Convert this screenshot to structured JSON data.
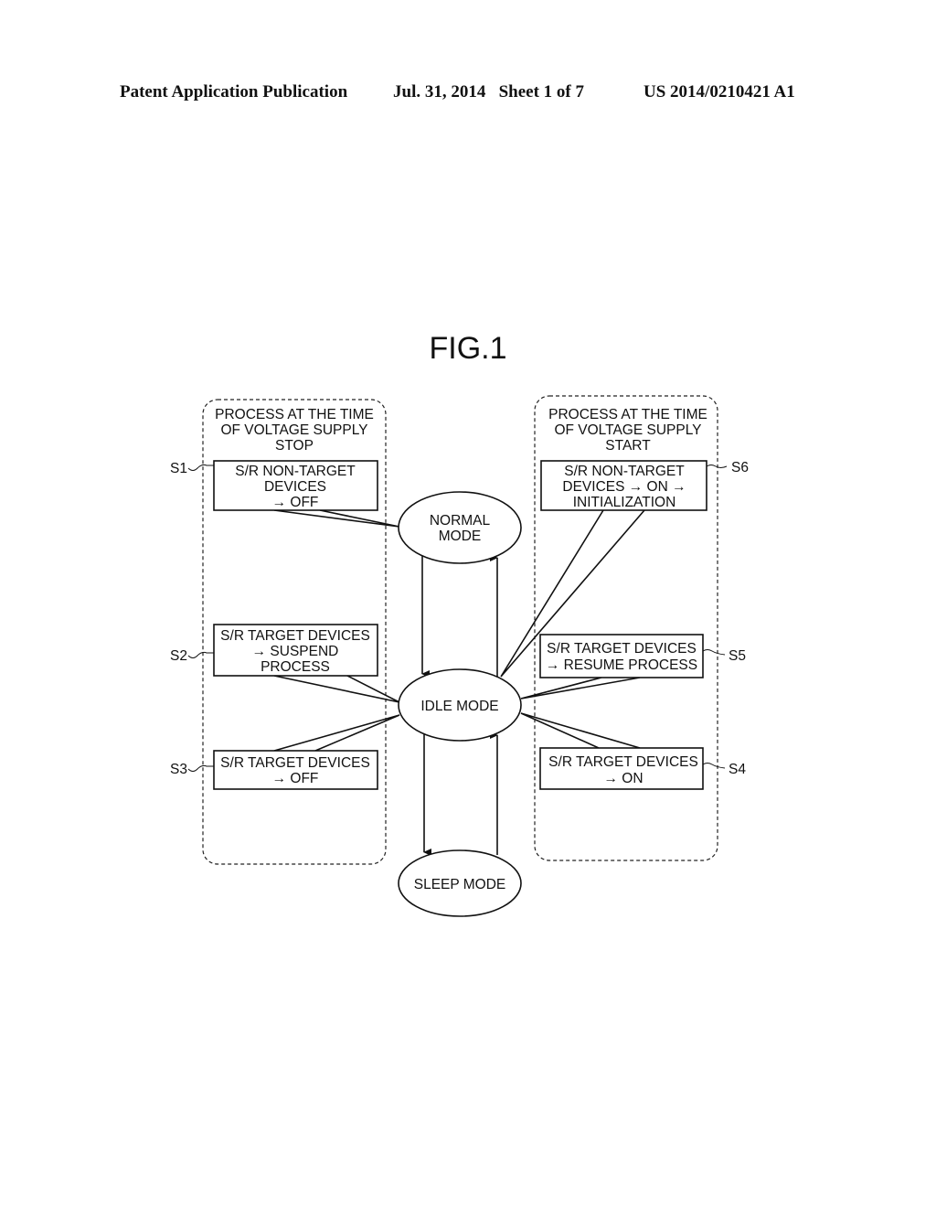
{
  "header": {
    "left": "Patent Application Publication",
    "middle": "Jul. 31, 2014   Sheet 1 of 7",
    "right": "US 2014/0210421 A1"
  },
  "figure": {
    "title": "FIG.1",
    "groups": {
      "stop": [
        "PROCESS AT THE TIME",
        "OF VOLTAGE SUPPLY",
        "STOP"
      ],
      "start": [
        "PROCESS AT THE TIME",
        "OF VOLTAGE SUPPLY",
        "START"
      ]
    },
    "modes": {
      "normal": [
        "NORMAL",
        "MODE"
      ],
      "idle": [
        "IDLE MODE"
      ],
      "sleep": [
        "SLEEP MODE"
      ]
    },
    "steps": {
      "s1": {
        "label": "S1",
        "lines": [
          "S/R NON-TARGET",
          "DEVICES",
          "→ OFF"
        ]
      },
      "s2": {
        "label": "S2",
        "lines": [
          "S/R TARGET DEVICES",
          "→ SUSPEND",
          "PROCESS"
        ]
      },
      "s3": {
        "label": "S3",
        "lines": [
          "S/R TARGET DEVICES",
          "→ OFF"
        ]
      },
      "s4": {
        "label": "S4",
        "lines": [
          "S/R TARGET DEVICES",
          "→ ON"
        ]
      },
      "s5": {
        "label": "S5",
        "lines": [
          "S/R TARGET DEVICES",
          "→ RESUME PROCESS"
        ]
      },
      "s6": {
        "label": "S6",
        "lines": [
          "S/R NON-TARGET",
          "DEVICES → ON →",
          "INITIALIZATION"
        ]
      }
    }
  }
}
